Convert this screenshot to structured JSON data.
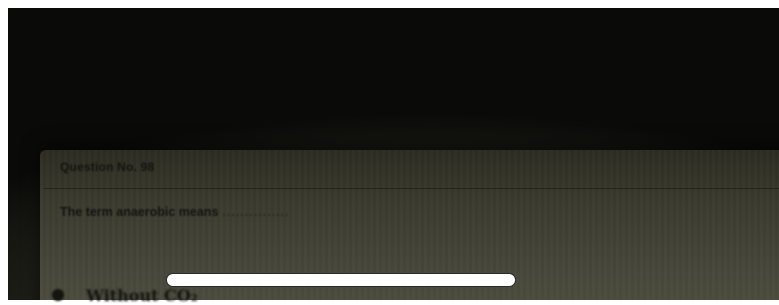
{
  "question": {
    "header": "Question No. 98",
    "text": "The term anaerobic means",
    "blank": "..............."
  },
  "options": [
    {
      "label": "Without CO₂"
    }
  ],
  "colors": {
    "screen": "#46463a",
    "text": "#141410",
    "home_indicator": "#ffffff"
  }
}
